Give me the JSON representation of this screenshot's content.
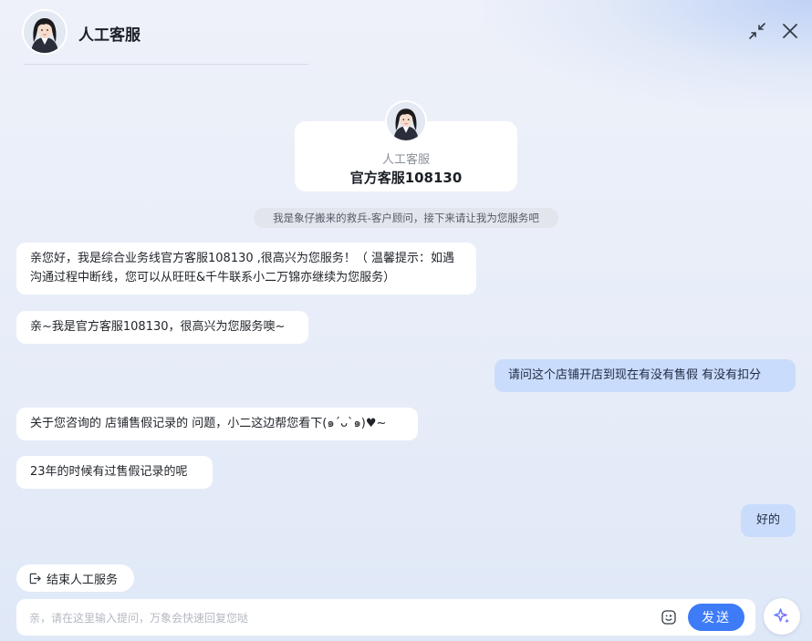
{
  "header": {
    "title": "人工客服"
  },
  "agent_card": {
    "role": "人工客服",
    "name": "官方客服108130"
  },
  "system_note": "我是象仔搬来的救兵-客户顾问，接下来请让我为您服务吧",
  "messages": [
    {
      "sender": "agent",
      "text": "亲您好，我是综合业务线官方客服108130 ,很高兴为您服务！（ 温馨提示：如遇沟通过程中断线，您可以从旺旺&千牛联系小二万锦亦继续为您服务）"
    },
    {
      "sender": "agent",
      "text": "亲~我是官方客服108130，很高兴为您服务噢~"
    },
    {
      "sender": "user",
      "text": "请问这个店铺开店到现在有没有售假 有没有扣分"
    },
    {
      "sender": "agent",
      "text": "关于您咨询的 店铺售假记录的 问题，小二这边帮您看下(๑´ᴗ`๑)♥~"
    },
    {
      "sender": "agent",
      "text": "23年的时候有过售假记录的呢"
    },
    {
      "sender": "user",
      "text": "好的"
    }
  ],
  "end_service_label": "结束人工服务",
  "input": {
    "placeholder": "亲，请在这里输入提问，万象会快速回复您哒",
    "value": ""
  },
  "send_label": "发送",
  "colors": {
    "accent": "#3e7bf7",
    "user_bubble": "#c9dcfb",
    "agent_bubble": "#ffffff"
  },
  "icons": {
    "minimize": "minimize-icon",
    "close": "close-icon",
    "end_service": "exit-icon",
    "emoji": "emoji-icon",
    "ai": "sparkle-icon"
  }
}
